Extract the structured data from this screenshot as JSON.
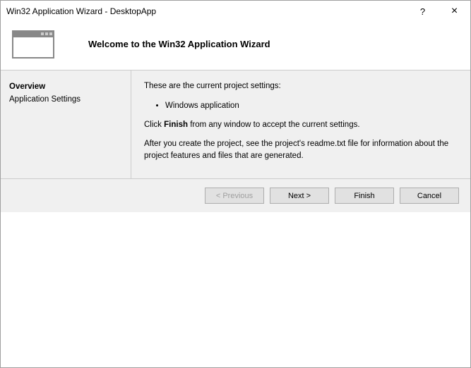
{
  "window": {
    "title": "Win32 Application Wizard - DesktopApp",
    "help": "?",
    "close": "×"
  },
  "header": {
    "title": "Welcome to the Win32 Application Wizard"
  },
  "sidebar": {
    "items": [
      {
        "label": "Overview",
        "active": true
      },
      {
        "label": "Application Settings",
        "active": false
      }
    ]
  },
  "content": {
    "intro": "These are the current project settings:",
    "bullets": [
      "Windows application"
    ],
    "line2_pre": "Click ",
    "line2_bold": "Finish",
    "line2_post": " from any window to accept the current settings.",
    "line3": "After you create the project, see the project's readme.txt file for information about the project features and files that are generated."
  },
  "footer": {
    "previous": "< Previous",
    "next": "Next >",
    "finish": "Finish",
    "cancel": "Cancel"
  }
}
